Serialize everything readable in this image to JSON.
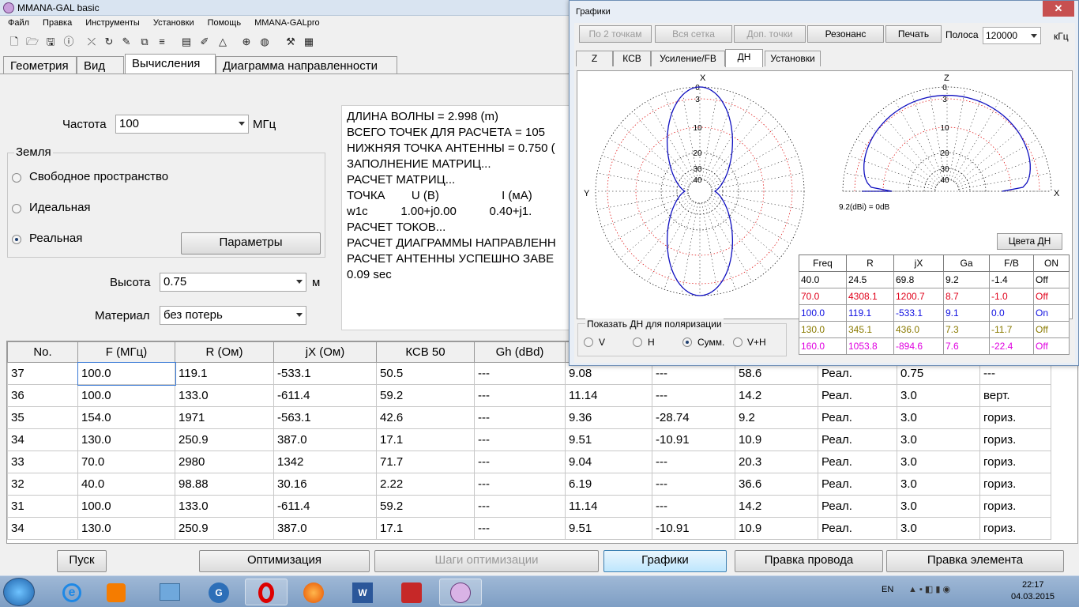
{
  "window": {
    "title": "MMANA-GAL basic"
  },
  "menu": [
    "Файл",
    "Правка",
    "Инструменты",
    "Установки",
    "Помощь",
    "MMANA-GALpro"
  ],
  "toolbar_icons": [
    "new-file-icon",
    "open-folder-icon",
    "save-icon",
    "info-icon",
    "wire-icon",
    "rotate-icon",
    "edit-icon",
    "segment-icon",
    "page-icon",
    "pen-icon",
    "triangle-icon",
    "target-icon",
    "sphere-icon",
    "tools-icon",
    "calculator-icon"
  ],
  "tabs": [
    "Геометрия",
    "Вид",
    "Вычисления",
    "Диаграмма направленности"
  ],
  "active_tab": "Вычисления",
  "calc": {
    "freq_label": "Частота",
    "freq_value": "100",
    "freq_unit": "МГц",
    "ground_group": "Земля",
    "ground_options": [
      "Свободное пространство",
      "Идеальная",
      "Реальная"
    ],
    "ground_selected": "Реальная",
    "params_button": "Параметры",
    "height_label": "Высота",
    "height_value": "0.75",
    "height_unit": "м",
    "material_label": "Материал",
    "material_value": "без потерь"
  },
  "log": [
    "ДЛИНА ВОЛНЫ = 2.998 (m)",
    "ВСЕГО ТОЧЕК ДЛЯ РАСЧЕТА = 105",
    "НИЖНЯЯ ТОЧКА АНТЕННЫ = 0.750 (",
    "ЗАПОЛНЕНИЕ МАТРИЦ...",
    "РАСЧЕТ МАТРИЦ...",
    "ТОЧКА        U (В)                   I (мА)",
    "w1c          1.00+j0.00          0.40+j1.",
    "РАСЧЕТ ТОКОВ...",
    "РАСЧЕТ ДИАГРАММЫ НАПРАВЛЕНН",
    "РАСЧЕТ АНТЕННЫ УСПЕШНО ЗАВЕ",
    "0.09 sec"
  ],
  "grid": {
    "headers": [
      "No.",
      "F (МГц)",
      "R (Ом)",
      "jX (Ом)",
      "КСВ 50",
      "Gh (dBd)",
      "",
      "",
      "",
      "",
      "",
      ""
    ],
    "rows": [
      [
        "37",
        "100.0",
        "119.1",
        "-533.1",
        "50.5",
        "---",
        "9.08",
        "---",
        "58.6",
        "Реал.",
        "0.75",
        "---"
      ],
      [
        "36",
        "100.0",
        "133.0",
        "-611.4",
        "59.2",
        "---",
        "11.14",
        "---",
        "14.2",
        "Реал.",
        "3.0",
        "верт."
      ],
      [
        "35",
        "154.0",
        "1971",
        "-563.1",
        "42.6",
        "---",
        "9.36",
        "-28.74",
        "9.2",
        "Реал.",
        "3.0",
        "гориз."
      ],
      [
        "34",
        "130.0",
        "250.9",
        "387.0",
        "17.1",
        "---",
        "9.51",
        "-10.91",
        "10.9",
        "Реал.",
        "3.0",
        "гориз."
      ],
      [
        "33",
        "70.0",
        "2980",
        "1342",
        "71.7",
        "---",
        "9.04",
        "---",
        "20.3",
        "Реал.",
        "3.0",
        "гориз."
      ],
      [
        "32",
        "40.0",
        "98.88",
        "30.16",
        "2.22",
        "---",
        "6.19",
        "---",
        "36.6",
        "Реал.",
        "3.0",
        "гориз."
      ],
      [
        "31",
        "100.0",
        "133.0",
        "-611.4",
        "59.2",
        "---",
        "11.14",
        "---",
        "14.2",
        "Реал.",
        "3.0",
        "гориз."
      ],
      [
        "34",
        "130.0",
        "250.9",
        "387.0",
        "17.1",
        "---",
        "9.51",
        "-10.91",
        "10.9",
        "Реал.",
        "3.0",
        "гориз."
      ]
    ]
  },
  "bottom_buttons": {
    "start": "Пуск",
    "optimize": "Оптимизация",
    "opt_steps": "Шаги оптимизации",
    "graphs": "Графики",
    "edit_wire": "Правка провода",
    "edit_element": "Правка элемента"
  },
  "popup": {
    "title": "Графики",
    "close": "✕",
    "buttons": [
      "По 2 точкам",
      "Вся сетка",
      "Доп. точки",
      "Резонанс",
      "Печать"
    ],
    "band_label": "Полоса",
    "band_value": "120000",
    "band_unit": "кГц",
    "tabs": [
      "Z",
      "КСВ",
      "Усиление/FB",
      "ДН",
      "Установки"
    ],
    "active_tab": "ДН",
    "polar_left": {
      "top_label": "X",
      "left_label": "Y",
      "rings": [
        "0",
        "3",
        "10",
        "20",
        "30",
        "40"
      ]
    },
    "polar_right": {
      "top_label": "Z",
      "right_label": "X",
      "rings": [
        "0",
        "3",
        "10",
        "20",
        "30",
        "40"
      ],
      "gain_note": "9.2(dBi) = 0dB"
    },
    "colors_button": "Цвета ДН",
    "pol_group": "Показать ДН для поляризации",
    "pol_options": [
      "V",
      "H",
      "Сумм.",
      "V+H"
    ],
    "pol_selected": "Сумм.",
    "table_headers": [
      "Freq",
      "R",
      "jX",
      "Ga",
      "F/B",
      "ON"
    ],
    "table_rows": [
      {
        "cells": [
          "40.0",
          "24.5",
          "69.8",
          "9.2",
          "-1.4",
          "Off"
        ],
        "color": "#000000"
      },
      {
        "cells": [
          "70.0",
          "4308.1",
          "1200.7",
          "8.7",
          "-1.0",
          "Off"
        ],
        "color": "#e0001a"
      },
      {
        "cells": [
          "100.0",
          "119.1",
          "-533.1",
          "9.1",
          "0.0",
          "On"
        ],
        "color": "#1010e0"
      },
      {
        "cells": [
          "130.0",
          "345.1",
          "436.0",
          "7.3",
          "-11.7",
          "Off"
        ],
        "color": "#8a7a00"
      },
      {
        "cells": [
          "160.0",
          "1053.8",
          "-894.6",
          "7.6",
          "-22.4",
          "Off"
        ],
        "color": "#e000e0"
      }
    ]
  },
  "taskbar": {
    "lang": "EN",
    "time": "22:17",
    "date": "04.03.2015",
    "apps": [
      "windows-start-icon",
      "ie-icon",
      "media-player-icon",
      "files-icon",
      "skype-icon",
      "opera-icon",
      "firefox-icon",
      "word-icon",
      "acrobat-icon",
      "mmana-icon"
    ]
  }
}
